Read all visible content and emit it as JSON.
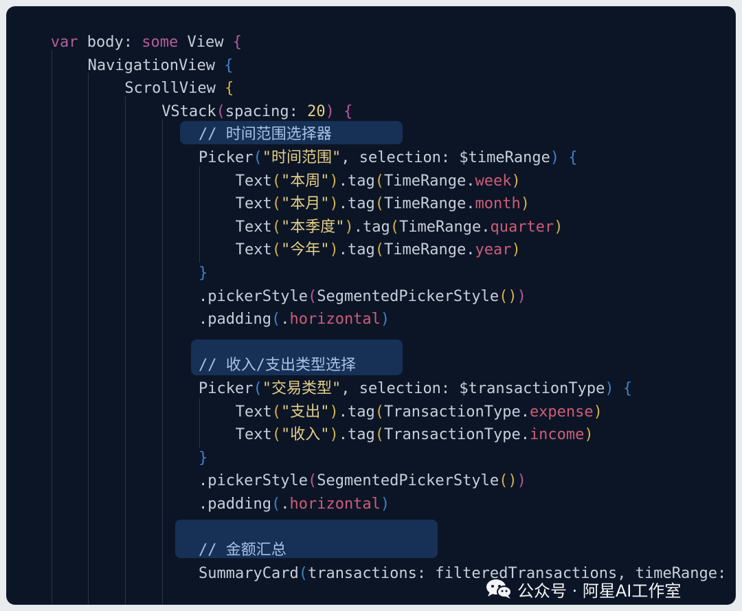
{
  "code_lines": [
    {
      "indent": 1,
      "parts": [
        [
          "var",
          "kw"
        ],
        [
          " body: ",
          ""
        ],
        [
          "some",
          "kw"
        ],
        [
          " View ",
          ""
        ],
        [
          "{",
          "b2"
        ]
      ]
    },
    {
      "indent": 2,
      "parts": [
        [
          "NavigationView ",
          ""
        ],
        [
          "{",
          "b3"
        ]
      ]
    },
    {
      "indent": 3,
      "parts": [
        [
          "ScrollView ",
          ""
        ],
        [
          "{",
          "b1"
        ]
      ]
    },
    {
      "indent": 4,
      "parts": [
        [
          "VStack",
          ""
        ],
        [
          "(",
          "b2"
        ],
        [
          "spacing: ",
          ""
        ],
        [
          "20",
          "num"
        ],
        [
          ") ",
          "b2"
        ],
        [
          "{",
          "b2"
        ]
      ]
    },
    {
      "indent": 5,
      "parts": [
        [
          "// 时间范围选择器",
          "cm"
        ]
      ]
    },
    {
      "indent": 5,
      "parts": [
        [
          "Picker",
          ""
        ],
        [
          "(",
          "b3"
        ],
        [
          "\"时间范围\"",
          "str"
        ],
        [
          ", selection: $timeRange",
          ""
        ],
        [
          ")",
          "b3"
        ],
        [
          " ",
          ""
        ],
        [
          "{",
          "b3"
        ]
      ]
    },
    {
      "indent": 6,
      "parts": [
        [
          "Text",
          ""
        ],
        [
          "(",
          "b1"
        ],
        [
          "\"本周\"",
          "str"
        ],
        [
          ")",
          "b1"
        ],
        [
          ".tag",
          ""
        ],
        [
          "(",
          "b1"
        ],
        [
          "TimeRange.",
          ""
        ],
        [
          "week",
          "prop"
        ],
        [
          ")",
          "b1"
        ]
      ]
    },
    {
      "indent": 6,
      "parts": [
        [
          "Text",
          ""
        ],
        [
          "(",
          "b1"
        ],
        [
          "\"本月\"",
          "str"
        ],
        [
          ")",
          "b1"
        ],
        [
          ".tag",
          ""
        ],
        [
          "(",
          "b1"
        ],
        [
          "TimeRange.",
          ""
        ],
        [
          "month",
          "prop"
        ],
        [
          ")",
          "b1"
        ]
      ]
    },
    {
      "indent": 6,
      "parts": [
        [
          "Text",
          ""
        ],
        [
          "(",
          "b1"
        ],
        [
          "\"本季度\"",
          "str"
        ],
        [
          ")",
          "b1"
        ],
        [
          ".tag",
          ""
        ],
        [
          "(",
          "b1"
        ],
        [
          "TimeRange.",
          ""
        ],
        [
          "quarter",
          "prop"
        ],
        [
          ")",
          "b1"
        ]
      ]
    },
    {
      "indent": 6,
      "parts": [
        [
          "Text",
          ""
        ],
        [
          "(",
          "b1"
        ],
        [
          "\"今年\"",
          "str"
        ],
        [
          ")",
          "b1"
        ],
        [
          ".tag",
          ""
        ],
        [
          "(",
          "b1"
        ],
        [
          "TimeRange.",
          ""
        ],
        [
          "year",
          "prop"
        ],
        [
          ")",
          "b1"
        ]
      ]
    },
    {
      "indent": 5,
      "parts": [
        [
          "}",
          "b3"
        ]
      ]
    },
    {
      "indent": 5,
      "parts": [
        [
          ".pickerStyle",
          ""
        ],
        [
          "(",
          "b2"
        ],
        [
          "SegmentedPickerStyle",
          ""
        ],
        [
          "()",
          "b1"
        ],
        [
          ")",
          "b2"
        ]
      ]
    },
    {
      "indent": 5,
      "parts": [
        [
          ".padding",
          ""
        ],
        [
          "(",
          "b3"
        ],
        [
          ".",
          ""
        ],
        [
          "horizontal",
          "prop"
        ],
        [
          ")",
          "b3"
        ]
      ]
    },
    {
      "indent": 5,
      "parts": []
    },
    {
      "indent": 5,
      "parts": [
        [
          "// 收入/支出类型选择",
          "cm"
        ]
      ]
    },
    {
      "indent": 5,
      "parts": [
        [
          "Picker",
          ""
        ],
        [
          "(",
          "b3"
        ],
        [
          "\"交易类型\"",
          "str"
        ],
        [
          ", selection: $transactionType",
          ""
        ],
        [
          ")",
          "b3"
        ],
        [
          " ",
          ""
        ],
        [
          "{",
          "b3"
        ]
      ]
    },
    {
      "indent": 6,
      "parts": [
        [
          "Text",
          ""
        ],
        [
          "(",
          "b1"
        ],
        [
          "\"支出\"",
          "str"
        ],
        [
          ")",
          "b1"
        ],
        [
          ".tag",
          ""
        ],
        [
          "(",
          "b1"
        ],
        [
          "TransactionType.",
          ""
        ],
        [
          "expense",
          "prop"
        ],
        [
          ")",
          "b1"
        ]
      ]
    },
    {
      "indent": 6,
      "parts": [
        [
          "Text",
          ""
        ],
        [
          "(",
          "b1"
        ],
        [
          "\"收入\"",
          "str"
        ],
        [
          ")",
          "b1"
        ],
        [
          ".tag",
          ""
        ],
        [
          "(",
          "b1"
        ],
        [
          "TransactionType.",
          ""
        ],
        [
          "income",
          "prop"
        ],
        [
          ")",
          "b1"
        ]
      ]
    },
    {
      "indent": 5,
      "parts": [
        [
          "}",
          "b3"
        ]
      ]
    },
    {
      "indent": 5,
      "parts": [
        [
          ".pickerStyle",
          ""
        ],
        [
          "(",
          "b2"
        ],
        [
          "SegmentedPickerStyle",
          ""
        ],
        [
          "()",
          "b1"
        ],
        [
          ")",
          "b2"
        ]
      ]
    },
    {
      "indent": 5,
      "parts": [
        [
          ".padding",
          ""
        ],
        [
          "(",
          "b3"
        ],
        [
          ".",
          ""
        ],
        [
          "horizontal",
          "prop"
        ],
        [
          ")",
          "b3"
        ]
      ]
    },
    {
      "indent": 5,
      "parts": []
    },
    {
      "indent": 5,
      "parts": [
        [
          "// 金额汇总",
          "cm"
        ]
      ]
    },
    {
      "indent": 5,
      "parts": [
        [
          "SummaryCard",
          ""
        ],
        [
          "(",
          "b3"
        ],
        [
          "transactions: filteredTransactions, timeRange:",
          ""
        ]
      ]
    }
  ],
  "watermark": {
    "text": "公众号 · 阿星AI工作室",
    "icon": "wechat-icon"
  }
}
